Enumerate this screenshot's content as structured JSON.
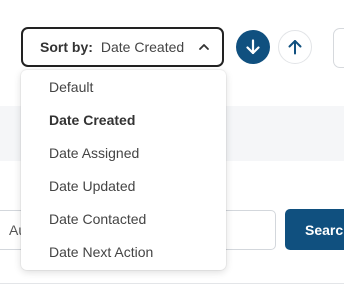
{
  "sort": {
    "label": "Sort by:",
    "selected": "Date Created",
    "options": [
      "Default",
      "Date Created",
      "Date Assigned",
      "Date Updated",
      "Date Contacted",
      "Date Next Action"
    ],
    "selected_index": 1
  },
  "search": {
    "input_value": "Au",
    "button_label": "Search"
  },
  "icons": {
    "sort_desc": "arrow-down-icon",
    "sort_asc": "arrow-up-icon",
    "dropdown_toggle": "chevron-up-icon"
  },
  "colors": {
    "accent": "#10507f",
    "background_band": "#f5f6f8"
  }
}
